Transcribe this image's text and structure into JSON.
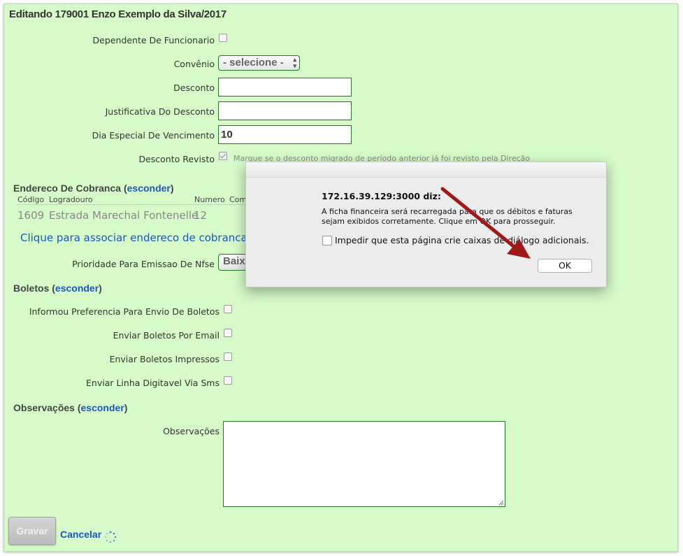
{
  "page": {
    "title": "Editando 179001 Enzo Exemplo da Silva/2017",
    "fields": {
      "dependente_label": "Dependente De Funcionario",
      "convenio_label": "Convênio",
      "convenio_value": "- selecione -",
      "desconto_label": "Desconto",
      "desconto_value": "",
      "justificativa_label": "Justificativa Do Desconto",
      "justificativa_value": "",
      "dia_label": "Dia Especial De Vencimento",
      "dia_value": "10",
      "revisto_label": "Desconto Revisto",
      "revisto_hint": "Marque se o desconto migrado de período anterior já foi revisto pela Direção"
    },
    "endereco": {
      "section_label": "Endereco De Cobranca",
      "toggle": "esconder",
      "col_codigo": "Código",
      "col_logradouro": "Logradouro",
      "col_numero": "Numero",
      "col_com": "Com",
      "codigo": "1609",
      "logradouro": "Estrada Marechal Fontenelle",
      "numero": "12",
      "assoc_link": "Clique para associar endereco de cobranca",
      "prioridade_label": "Prioridade Para Emissao De Nfse",
      "prioridade_value": "Baix"
    },
    "boletos": {
      "section_label": "Boletos",
      "toggle": "esconder",
      "preferencia_label": "Informou Preferencia Para Envio De Boletos",
      "email_label": "Enviar Boletos Por Email",
      "impressos_label": "Enviar Boletos Impressos",
      "sms_label": "Enviar Linha Digitavel Via Sms"
    },
    "observacoes": {
      "section_label": "Observações",
      "toggle": "esconder",
      "label": "Observações",
      "value": ""
    },
    "actions": {
      "gravar": "Gravar",
      "cancelar": "Cancelar"
    }
  },
  "dialog": {
    "title": "172.16.39.129:3000 diz:",
    "message": "A ficha financeira será recarregada para que os débitos e faturas sejam exibidos corretamente. Clique em OK para prosseguir.",
    "checkbox_label": "Impedir que esta página crie caixas de diálogo adicionais.",
    "ok_label": "OK"
  },
  "colors": {
    "background": "#d6fbc9",
    "link": "#1a56c6",
    "input_border": "#1f7a1f",
    "arrow": "#a01818"
  },
  "icons": [
    "chevron-updown-icon",
    "spinner-icon",
    "checkmark-icon",
    "annotation-arrow"
  ]
}
